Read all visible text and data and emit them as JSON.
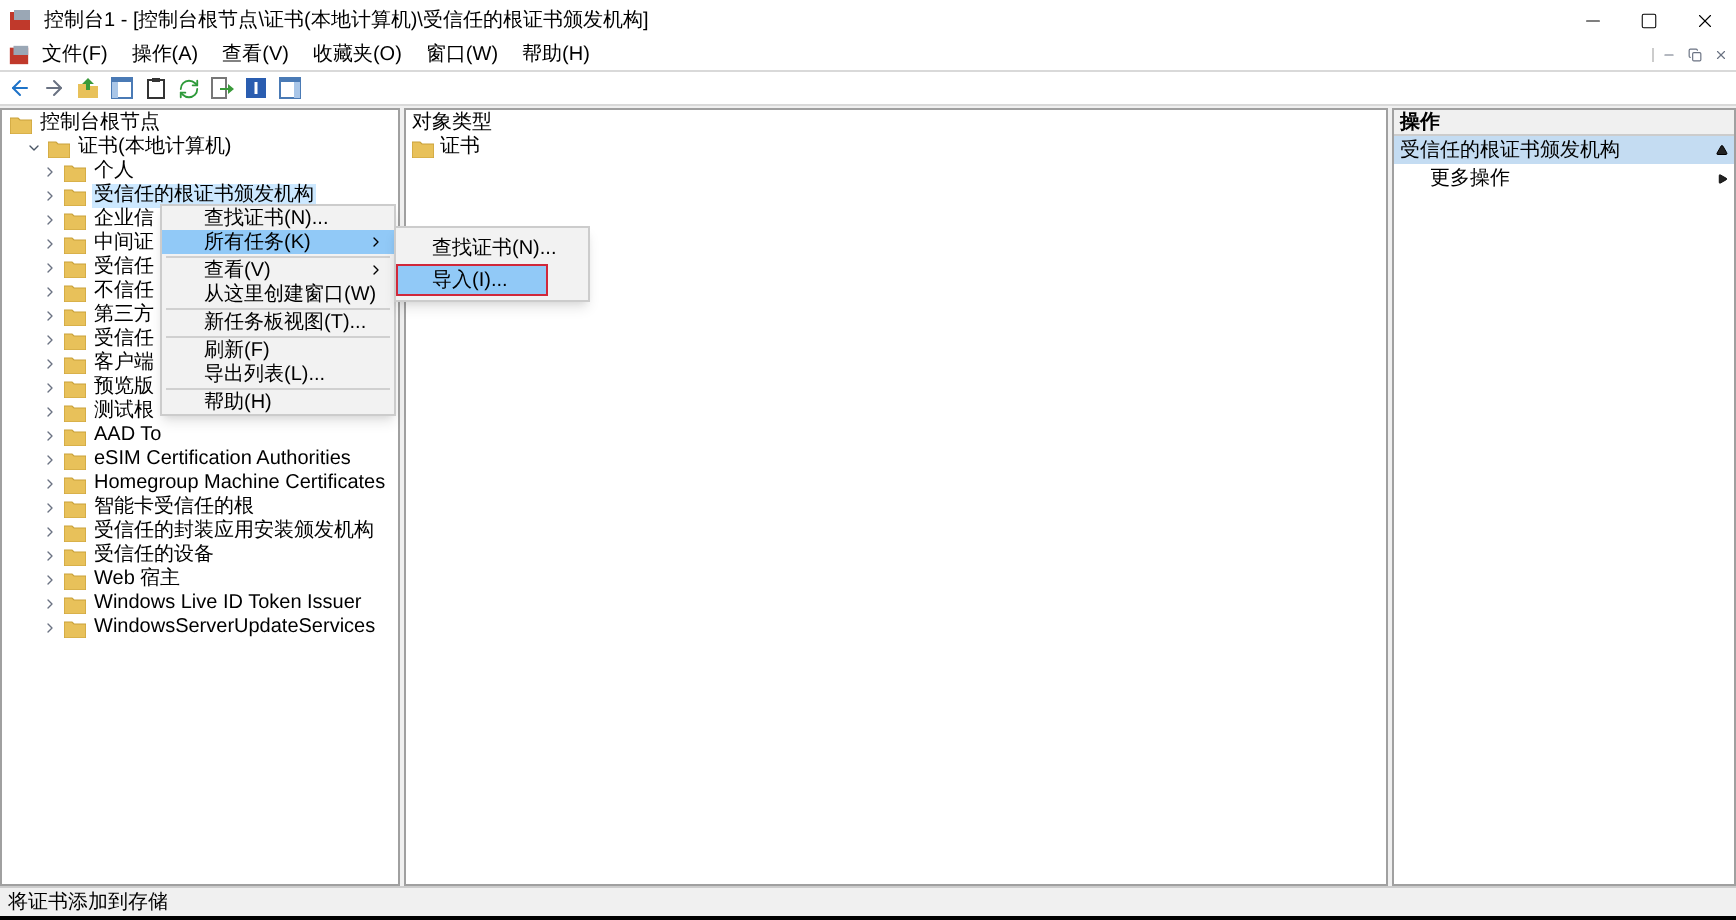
{
  "window": {
    "title": "控制台1 - [控制台根节点\\证书(本地计算机)\\受信任的根证书颁发机构]"
  },
  "menu_bar": [
    "文件(F)",
    "操作(A)",
    "查看(V)",
    "收藏夹(O)",
    "窗口(W)",
    "帮助(H)"
  ],
  "tree": {
    "label": "控制台根节点",
    "selected": false,
    "children": [
      {
        "label": "证书(本地计算机)",
        "selected": false,
        "expanded": true,
        "children": [
          {
            "label": "个人",
            "selected": false,
            "expanded": false
          },
          {
            "label": "受信任的根证书颁发机构",
            "selected": true,
            "expanded": false
          },
          {
            "label": "企业信",
            "selected": false,
            "expanded": false
          },
          {
            "label": "中间证",
            "selected": false,
            "expanded": false
          },
          {
            "label": "受信任",
            "selected": false,
            "expanded": false
          },
          {
            "label": "不信任",
            "selected": false,
            "expanded": false
          },
          {
            "label": "第三方",
            "selected": false,
            "expanded": false
          },
          {
            "label": "受信任",
            "selected": false,
            "expanded": false
          },
          {
            "label": "客户端",
            "selected": false,
            "expanded": false
          },
          {
            "label": "预览版",
            "selected": false,
            "expanded": false
          },
          {
            "label": "测试根",
            "selected": false,
            "expanded": false
          },
          {
            "label": "AAD To",
            "selected": false,
            "expanded": false
          },
          {
            "label": "eSIM Certification Authorities",
            "selected": false,
            "expanded": false
          },
          {
            "label": "Homegroup Machine Certificates",
            "selected": false,
            "expanded": false
          },
          {
            "label": "智能卡受信任的根",
            "selected": false,
            "expanded": false
          },
          {
            "label": "受信任的封装应用安装颁发机构",
            "selected": false,
            "expanded": false
          },
          {
            "label": "受信任的设备",
            "selected": false,
            "expanded": false
          },
          {
            "label": "Web 宿主",
            "selected": false,
            "expanded": false
          },
          {
            "label": "Windows Live ID Token Issuer",
            "selected": false,
            "expanded": false
          },
          {
            "label": "WindowsServerUpdateServices",
            "selected": false,
            "expanded": false
          }
        ]
      }
    ]
  },
  "content": {
    "header": "对象类型",
    "items": [
      "证书"
    ]
  },
  "actions": {
    "header": "操作",
    "section": {
      "label": "受信任的根证书颁发机构",
      "expanded": true
    },
    "items": [
      {
        "label": "更多操作"
      }
    ]
  },
  "context_menu": [
    {
      "kind": "item",
      "label": "查找证书(N)...",
      "selected": false,
      "submenu": false
    },
    {
      "kind": "item",
      "label": "所有任务(K)",
      "selected": true,
      "submenu": true
    },
    {
      "kind": "separator"
    },
    {
      "kind": "item",
      "label": "查看(V)",
      "selected": false,
      "submenu": true
    },
    {
      "kind": "item",
      "label": "从这里创建窗口(W)",
      "selected": false,
      "submenu": false
    },
    {
      "kind": "separator"
    },
    {
      "kind": "item",
      "label": "新任务板视图(T)...",
      "selected": false,
      "submenu": false
    },
    {
      "kind": "separator"
    },
    {
      "kind": "item",
      "label": "刷新(F)",
      "selected": false,
      "submenu": false
    },
    {
      "kind": "item",
      "label": "导出列表(L)...",
      "selected": false,
      "submenu": false
    },
    {
      "kind": "separator"
    },
    {
      "kind": "item",
      "label": "帮助(H)",
      "selected": false,
      "submenu": false
    }
  ],
  "submenu": [
    {
      "label": "查找证书(N)...",
      "selected": false,
      "outlined": false
    },
    {
      "label": "导入(I)...",
      "selected": true,
      "outlined": true
    }
  ],
  "status_bar": "将证书添加到存储"
}
